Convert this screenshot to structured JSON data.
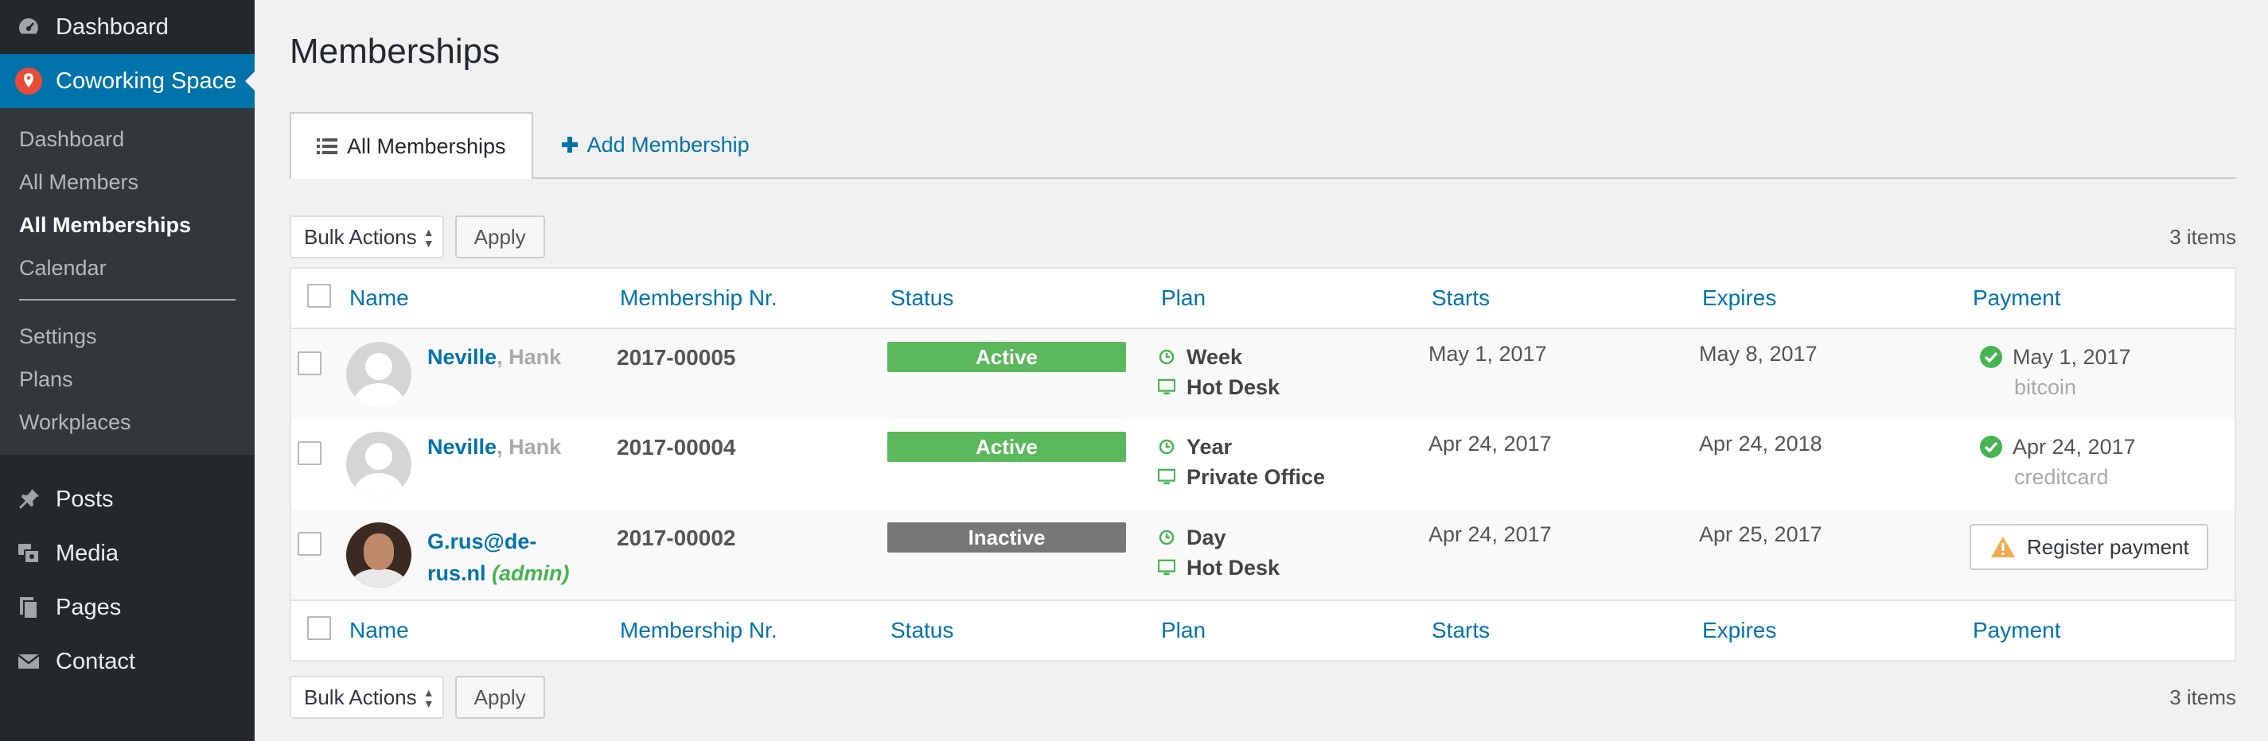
{
  "sidebar": {
    "top": [
      {
        "label": "Dashboard",
        "icon": "dashboard-icon"
      },
      {
        "label": "Coworking Space",
        "icon": "location-pin-icon"
      }
    ],
    "submenu": [
      "Dashboard",
      "All Members",
      "All Memberships",
      "Calendar"
    ],
    "submenu2": [
      "Settings",
      "Plans",
      "Workplaces"
    ],
    "lower": [
      {
        "label": "Posts",
        "icon": "pin-icon"
      },
      {
        "label": "Media",
        "icon": "media-icon"
      },
      {
        "label": "Pages",
        "icon": "pages-icon"
      },
      {
        "label": "Contact",
        "icon": "mail-icon"
      }
    ]
  },
  "page_title": "Memberships",
  "tabs": {
    "all": "All Memberships",
    "add": "Add Membership"
  },
  "tablenav": {
    "bulk": "Bulk Actions",
    "apply": "Apply",
    "count": "3 items"
  },
  "columns": [
    "Name",
    "Membership Nr.",
    "Status",
    "Plan",
    "Starts",
    "Expires",
    "Payment"
  ],
  "rows": [
    {
      "last": "Neville",
      "sep": ", ",
      "first": "Hank",
      "nr": "2017-00005",
      "status": "Active",
      "period": "Week",
      "workplace": "Hot Desk",
      "starts": "May 1, 2017",
      "expires": "May 8, 2017",
      "pay_date": "May 1, 2017",
      "pay_method": "bitcoin"
    },
    {
      "last": "Neville",
      "sep": ", ",
      "first": "Hank",
      "nr": "2017-00004",
      "status": "Active",
      "period": "Year",
      "workplace": "Private Office",
      "starts": "Apr 24, 2017",
      "expires": "Apr 24, 2018",
      "pay_date": "Apr 24, 2017",
      "pay_method": "creditcard"
    },
    {
      "email_1": "G.rus@de-",
      "email_2": "rus.nl",
      "role": "(admin)",
      "nr": "2017-00002",
      "status": "Inactive",
      "period": "Day",
      "workplace": "Hot Desk",
      "starts": "Apr 24, 2017",
      "expires": "Apr 25, 2017",
      "register": "Register payment"
    }
  ],
  "colors": {
    "active": "#5cb85c",
    "inactive": "#777777",
    "link": "#0073aa",
    "sidebar": "#23282d",
    "current": "#0073aa"
  }
}
